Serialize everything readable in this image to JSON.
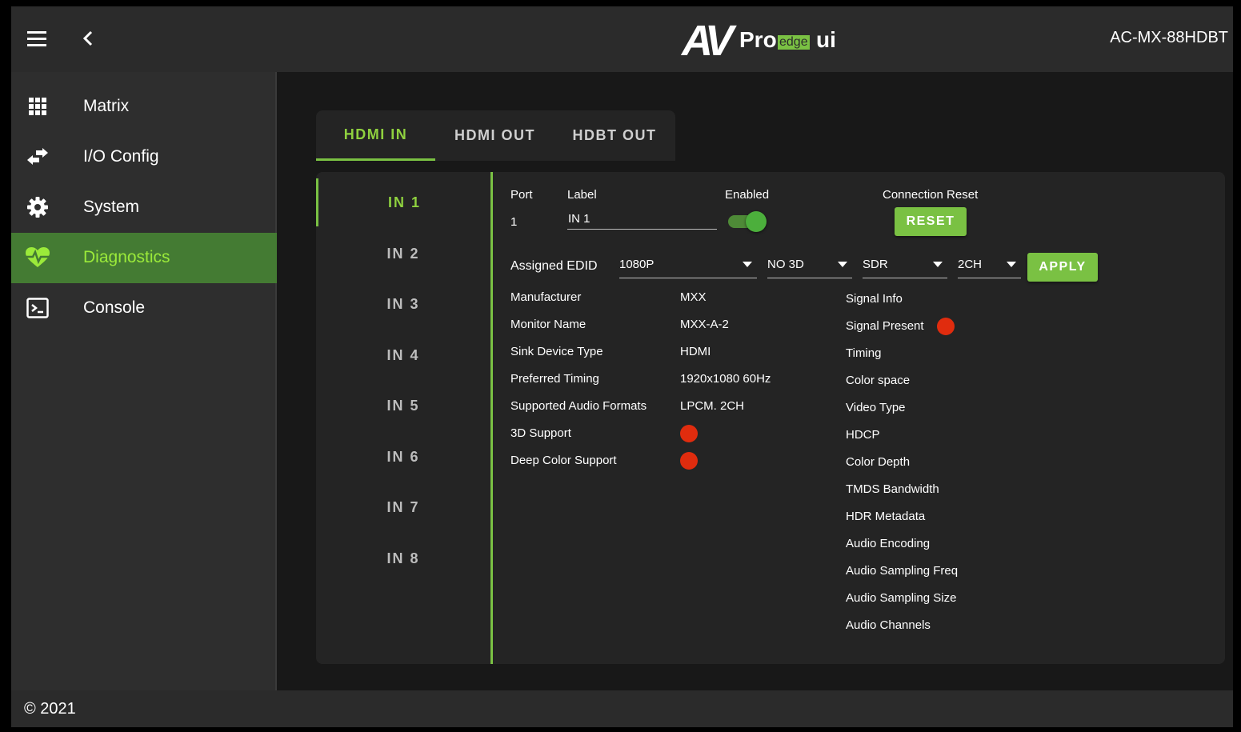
{
  "app": {
    "device_name": "AC-MX-88HDBT",
    "logo": {
      "av": "AV",
      "pro": "Pro",
      "edge": "edge",
      "ui": "ui"
    },
    "footer": "© 2021",
    "accent_color": "#7ac143",
    "active_text_color": "#9bea3a",
    "status_off_color": "#e02c0e"
  },
  "sidebar": {
    "items": [
      {
        "label": "Matrix",
        "icon": "grid-icon"
      },
      {
        "label": "I/O Config",
        "icon": "swap-arrows-icon"
      },
      {
        "label": "System",
        "icon": "gear-icon"
      },
      {
        "label": "Diagnostics",
        "icon": "heartbeat-icon",
        "active": true
      },
      {
        "label": "Console",
        "icon": "terminal-icon"
      }
    ]
  },
  "tabs": [
    {
      "label": "HDMI IN",
      "active": true
    },
    {
      "label": "HDMI OUT"
    },
    {
      "label": "HDBT OUT"
    }
  ],
  "inputs": [
    "IN 1",
    "IN 2",
    "IN 3",
    "IN 4",
    "IN 5",
    "IN 6",
    "IN 7",
    "IN 8"
  ],
  "selected_input": "IN 1",
  "port": {
    "port_header": "Port",
    "port_value": "1",
    "label_header": "Label",
    "label_value": "IN 1",
    "enabled_header": "Enabled",
    "enabled": true,
    "reset_header": "Connection Reset",
    "reset_button": "RESET"
  },
  "edid": {
    "label": "Assigned EDID",
    "resolution": "1080P",
    "mode_3d": "NO 3D",
    "dynamic_range": "SDR",
    "audio": "2CH",
    "apply_button": "APPLY"
  },
  "sink_info": {
    "rows": [
      {
        "label": "Manufacturer",
        "value": "MXX"
      },
      {
        "label": "Monitor Name",
        "value": "MXX-A-2"
      },
      {
        "label": "Sink Device Type",
        "value": "HDMI"
      },
      {
        "label": "Preferred Timing",
        "value": "1920x1080 60Hz"
      },
      {
        "label": "Supported Audio Formats",
        "value": "LPCM. 2CH"
      },
      {
        "label": "3D Support",
        "status": "off"
      },
      {
        "label": "Deep Color Support",
        "status": "off"
      }
    ]
  },
  "signal_info": {
    "title": "Signal Info",
    "signal_present_label": "Signal Present",
    "signal_present_status": "off",
    "fields": [
      "Timing",
      "Color space",
      "Video Type",
      "HDCP",
      "Color Depth",
      "TMDS Bandwidth",
      "HDR Metadata",
      "Audio Encoding",
      "Audio Sampling Freq",
      "Audio Sampling Size",
      "Audio Channels"
    ]
  }
}
